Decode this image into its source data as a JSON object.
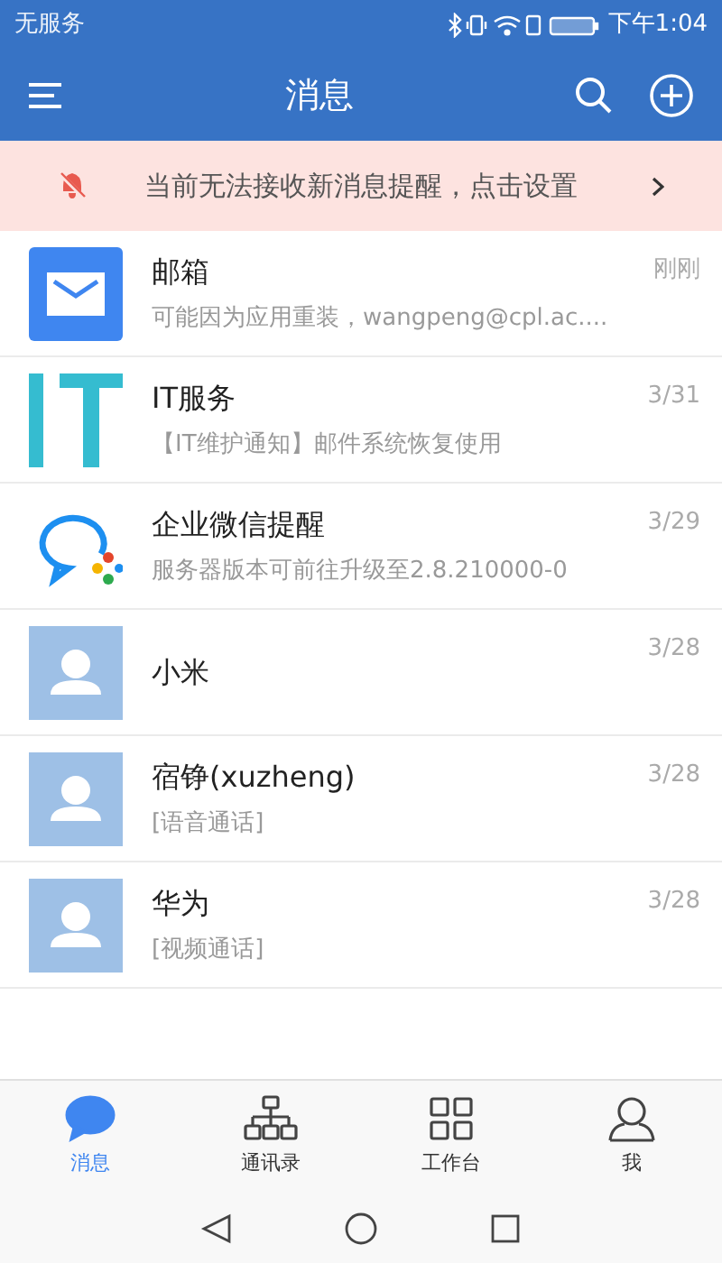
{
  "status_bar": {
    "carrier": "无服务",
    "time": "下午1:04"
  },
  "header": {
    "title": "消息"
  },
  "notice": {
    "text": "当前无法接收新消息提醒，点击设置"
  },
  "conversations": [
    {
      "kind": "mail",
      "name": "邮箱",
      "preview": "可能因为应用重装，wangpeng@cpl.ac....",
      "time": "刚刚"
    },
    {
      "kind": "it",
      "name": "IT服务",
      "preview": "【IT维护通知】邮件系统恢复使用",
      "time": "3/31"
    },
    {
      "kind": "wecom",
      "name": "企业微信提醒",
      "preview": "服务器版本可前往升级至2.8.210000-0",
      "time": "3/29"
    },
    {
      "kind": "person",
      "name": "小米",
      "time": "3/28"
    },
    {
      "kind": "person",
      "name": "宿铮(xuzheng)",
      "preview": "[语音通话]",
      "time": "3/28"
    },
    {
      "kind": "person",
      "name": "华为",
      "preview": "[视频通话]",
      "time": "3/28"
    }
  ],
  "tabs": [
    {
      "kind": "chat",
      "label": "消息",
      "selected": true
    },
    {
      "kind": "org",
      "label": "通讯录",
      "selected": false
    },
    {
      "kind": "grid",
      "label": "工作台",
      "selected": false
    },
    {
      "kind": "user",
      "label": "我",
      "selected": false
    }
  ]
}
